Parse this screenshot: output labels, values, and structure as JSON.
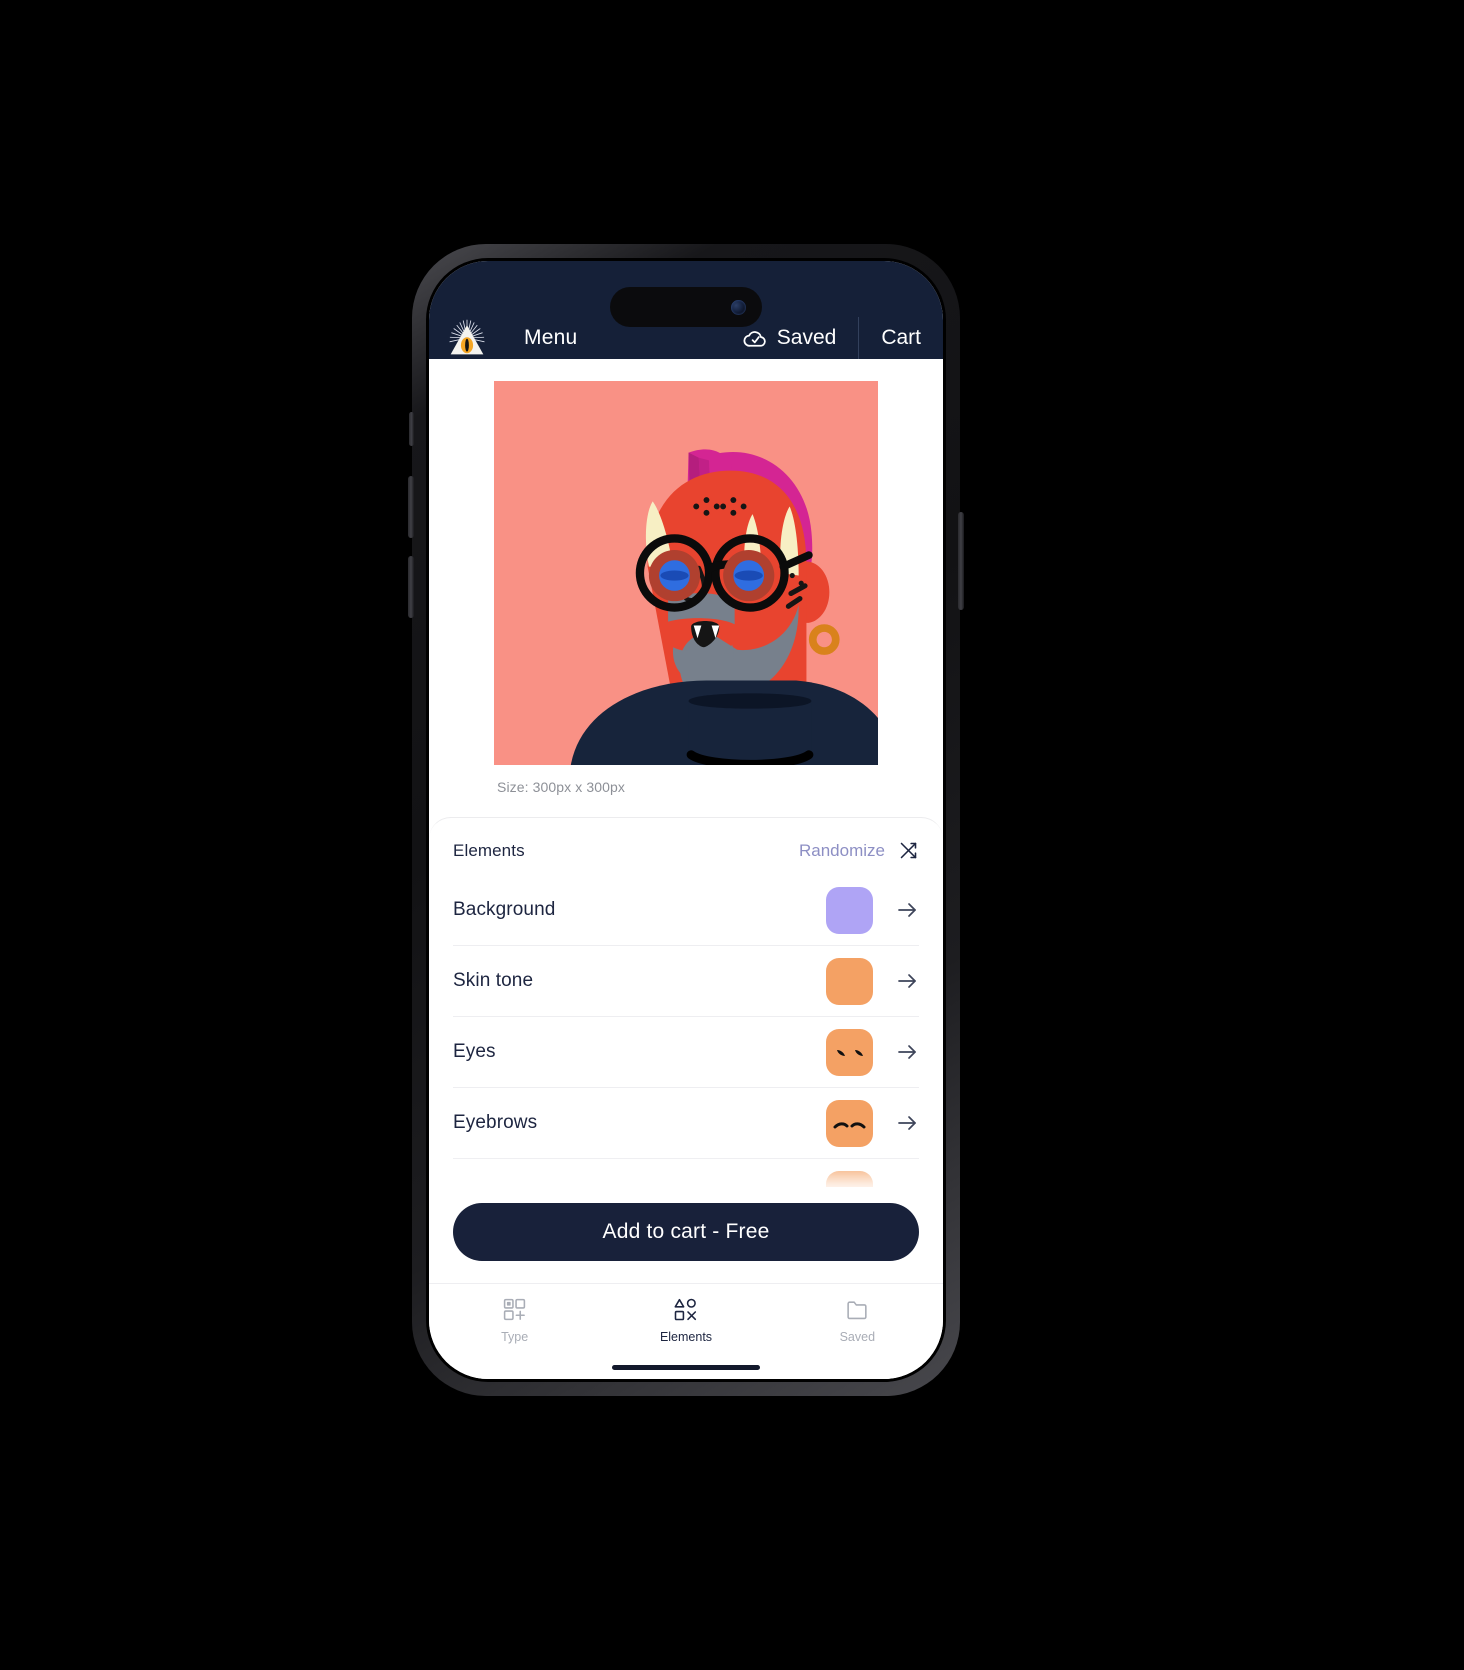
{
  "app": {
    "header": {
      "logo_icon": "eye-triangle-logo",
      "menu_label": "Menu",
      "saved_label": "Saved",
      "saved_icon": "cloud-check-icon",
      "cart_label": "Cart"
    },
    "preview": {
      "size_label": "Size: 300px x 300px",
      "background_color": "#F99185",
      "avatar": {
        "skin_color": "#E8442F",
        "skin_shadow": "#B52F25",
        "hair_color": "#D42593",
        "hair_shadow": "#B51E7E",
        "horn_color": "#F7EFC4",
        "beard_color": "#77808C",
        "glasses_color": "#0B0B0B",
        "eye_color": "#2F6DE0",
        "earring_color": "#D9821C",
        "shirt_color": "#17243B"
      }
    },
    "elements_panel": {
      "title": "Elements",
      "randomize_label": "Randomize",
      "randomize_icon": "shuffle-icon",
      "rows": [
        {
          "label": "Background",
          "swatch_type": "solid",
          "swatch_color": "#AFA4F5",
          "arrow_icon": "arrow-right-icon"
        },
        {
          "label": "Skin tone",
          "swatch_type": "solid",
          "swatch_color": "#F4A164",
          "arrow_icon": "arrow-right-icon"
        },
        {
          "label": "Eyes",
          "swatch_type": "face-eyes",
          "swatch_color": "#F4A164",
          "arrow_icon": "arrow-right-icon"
        },
        {
          "label": "Eyebrows",
          "swatch_type": "face-eyebrows",
          "swatch_color": "#F4A164",
          "arrow_icon": "arrow-right-icon"
        },
        {
          "label": "",
          "swatch_type": "solid",
          "swatch_color": "#F4A164",
          "arrow_icon": "arrow-right-icon"
        }
      ]
    },
    "cart": {
      "add_to_cart_label": "Add to cart - Free"
    },
    "tabbar": {
      "tabs": [
        {
          "label": "Type",
          "icon": "shapes-plus-icon",
          "active": false
        },
        {
          "label": "Elements",
          "icon": "shapes-grid-icon",
          "active": true
        },
        {
          "label": "Saved",
          "icon": "folder-icon",
          "active": false
        }
      ]
    }
  },
  "colors": {
    "header_bg": "#152038",
    "accent_dark": "#18213a",
    "randomize_text": "#8d8fc4",
    "muted_text": "#8d9097"
  }
}
